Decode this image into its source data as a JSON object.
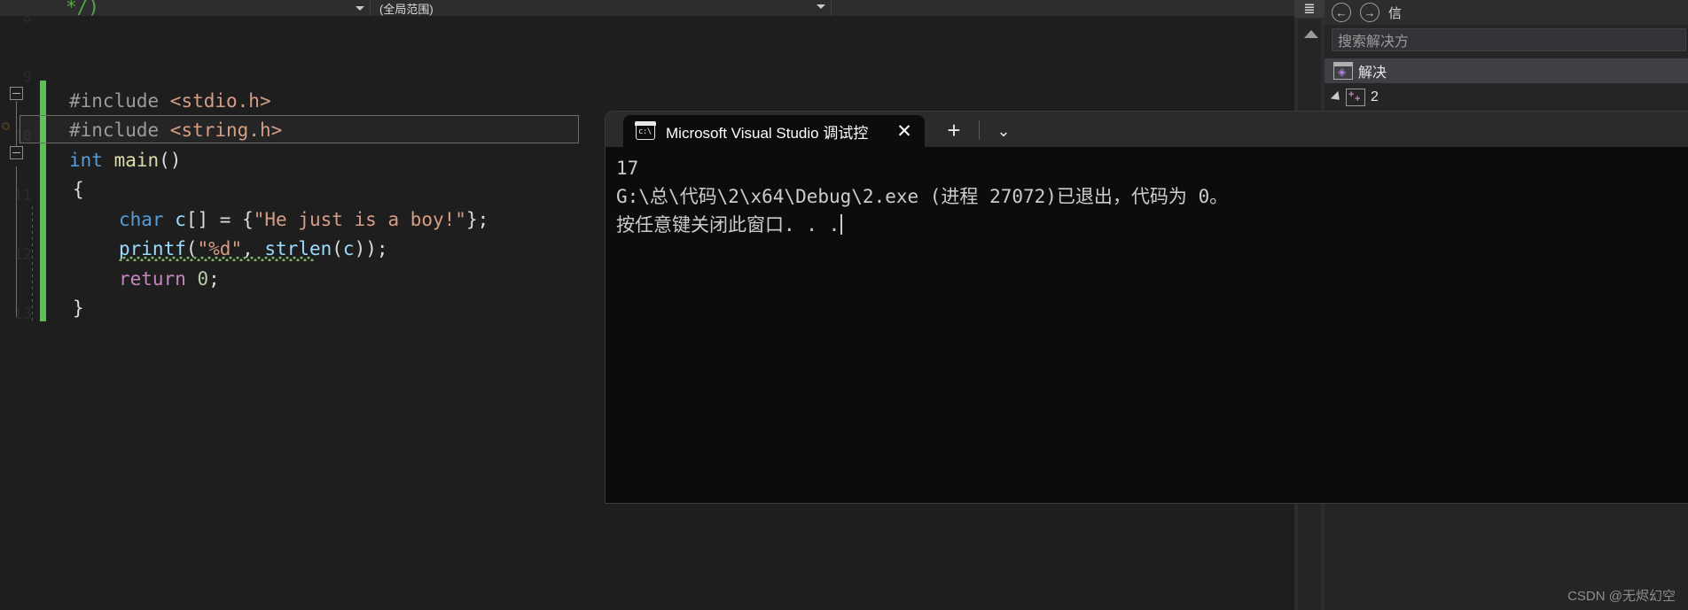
{
  "editor": {
    "navbar": {
      "left_label": "",
      "scope_label": "(全局范围)",
      "right_label": "",
      "caret_icon": "chevron-down-icon"
    },
    "gutter_numbers": [
      "8",
      "9",
      "10",
      "11",
      "12",
      "13"
    ],
    "code_lines": [
      {
        "indent": 0,
        "tokens": [
          {
            "t": "*/)",
            "c": "k-cmt"
          }
        ]
      },
      {
        "indent": 0,
        "tokens": []
      },
      {
        "indent": 0,
        "tokens": [
          {
            "t": "#include ",
            "c": "k-pre"
          },
          {
            "t": "<stdio.h>",
            "c": "k-inc"
          }
        ]
      },
      {
        "indent": 0,
        "tokens": [
          {
            "t": "#include ",
            "c": "k-pre"
          },
          {
            "t": "<string.h>",
            "c": "k-inc"
          }
        ]
      },
      {
        "indent": 0,
        "tokens": [
          {
            "t": "int ",
            "c": "k-type"
          },
          {
            "t": "main",
            "c": "k-fn"
          },
          {
            "t": "()",
            "c": "k-plain"
          }
        ]
      },
      {
        "indent": 0,
        "tokens": [
          {
            "t": "{",
            "c": "k-plain"
          }
        ]
      },
      {
        "indent": 1,
        "tokens": [
          {
            "t": "char ",
            "c": "k-type"
          },
          {
            "t": "c",
            "c": "k-id"
          },
          {
            "t": "[] = {",
            "c": "k-plain"
          },
          {
            "t": "\"He just is a boy!\"",
            "c": "k-str"
          },
          {
            "t": "};",
            "c": "k-plain"
          }
        ]
      },
      {
        "indent": 1,
        "tokens": [
          {
            "t": "printf",
            "c": "k-id"
          },
          {
            "t": "(",
            "c": "k-plain"
          },
          {
            "t": "\"%d\"",
            "c": "k-str"
          },
          {
            "t": ", ",
            "c": "k-plain"
          },
          {
            "t": "strlen",
            "c": "k-id"
          },
          {
            "t": "(",
            "c": "k-plain"
          },
          {
            "t": "c",
            "c": "k-id"
          },
          {
            "t": "));",
            "c": "k-plain"
          }
        ]
      },
      {
        "indent": 1,
        "tokens": [
          {
            "t": "return ",
            "c": "k-ret"
          },
          {
            "t": "0",
            "c": "k-num"
          },
          {
            "t": ";",
            "c": "k-plain"
          }
        ]
      },
      {
        "indent": 0,
        "tokens": [
          {
            "t": "}",
            "c": "k-plain"
          }
        ]
      }
    ]
  },
  "terminal": {
    "tab_title": "Microsoft Visual Studio 调试控",
    "tab_icon": "console-icon",
    "close_icon": "close-icon",
    "new_tab_icon": "plus-icon",
    "dropdown_icon": "chevron-down-icon",
    "output_lines": [
      "17",
      "G:\\总\\代码\\2\\x64\\Debug\\2.exe (进程 27072)已退出，代码为 0。",
      "按任意键关闭此窗口. . ."
    ]
  },
  "solution_explorer": {
    "back_icon": "arrow-left-icon",
    "forward_icon": "arrow-right-icon",
    "toolbar_extra": "信",
    "search_placeholder": "搜索解决方",
    "items": [
      {
        "label": "解决",
        "icon": "solution-icon",
        "selected": true,
        "expander": false
      },
      {
        "label": "2",
        "icon": "project-icon",
        "selected": false,
        "expander": true
      }
    ]
  },
  "scrollbar": {
    "pin_icon": "split-window-icon",
    "up_arrow_icon": "arrow-up-icon"
  },
  "watermark": "CSDN @无烬幻空",
  "colors": {
    "editor_bg": "#1e1e1e",
    "chrome_bg": "#2d2d30",
    "terminal_bg": "#0c0c0c",
    "terminal_chrome": "#2b2b2b",
    "change_bar": "#57c351",
    "accent_purple": "#b180d7"
  }
}
